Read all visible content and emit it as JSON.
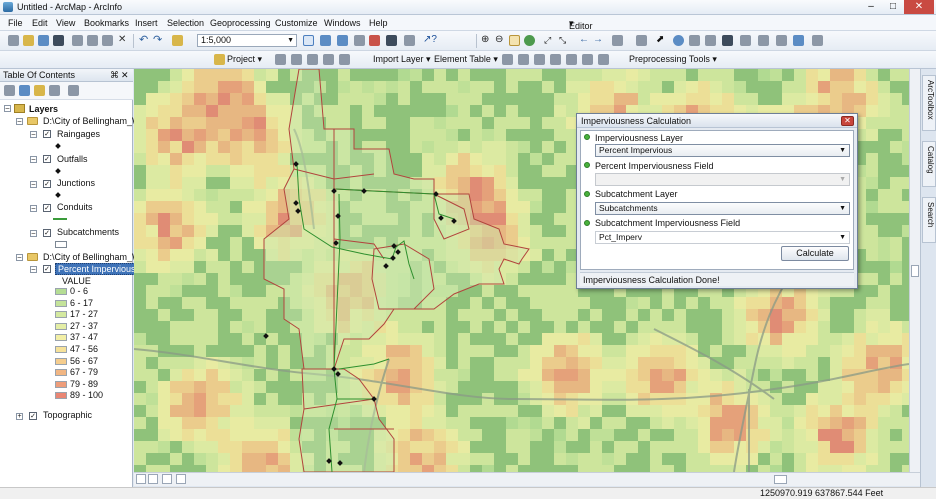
{
  "window": {
    "title": "Untitled - ArcMap - ArcInfo"
  },
  "menu": [
    "File",
    "Edit",
    "View",
    "Bookmarks",
    "Insert",
    "Selection",
    "Geoprocessing",
    "Customize",
    "Windows",
    "Help"
  ],
  "toolbar": {
    "scale": "1:5,000",
    "editor_label": "Editor"
  },
  "toolbar2": {
    "project_label": "Project",
    "import_layer_label": "Import Layer",
    "element_table_label": "Element Table",
    "preprocessing_label": "Preprocessing Tools"
  },
  "toc": {
    "title": "Table Of Contents",
    "root": "Layers",
    "group1": "D:\\City of Bellingham_W",
    "layers": [
      "Raingages",
      "Outfalls",
      "Junctions",
      "Conduits",
      "Subcatchments"
    ],
    "group2": "D:\\City of Bellingham_W",
    "raster_layer": "Percent Impervious",
    "value_header": "VALUE",
    "legend": [
      {
        "label": "0 - 6",
        "color": "#b5dd94"
      },
      {
        "label": "6 - 17",
        "color": "#c4e39a"
      },
      {
        "label": "17 - 27",
        "color": "#d4e9a0"
      },
      {
        "label": "27 - 37",
        "color": "#e4eea6"
      },
      {
        "label": "37 - 47",
        "color": "#f2efa6"
      },
      {
        "label": "47 - 56",
        "color": "#f6e29a"
      },
      {
        "label": "56 - 67",
        "color": "#f5cd8e"
      },
      {
        "label": "67 - 79",
        "color": "#f1b683"
      },
      {
        "label": "79 - 89",
        "color": "#ee9d7a"
      },
      {
        "label": "89 - 100",
        "color": "#e98674"
      }
    ],
    "basemap": "Topographic"
  },
  "right_tabs": [
    "ArcToolbox",
    "Catalog",
    "Search"
  ],
  "dialog": {
    "title": "Imperviousness Calculation",
    "layer_label": "Imperviousness Layer",
    "layer_value": "Percent Impervious",
    "field_label": "Percent Imperviousness Field",
    "field_value": "",
    "sub_label": "Subcatchment Layer",
    "sub_value": "Subcatchments",
    "sub_field_label": "Subcatchment Imperviousness Field",
    "sub_field_value": "Pct_Imperv",
    "calculate_label": "Calculate",
    "status": "Imperviousness Calculation Done!"
  },
  "status": {
    "coords": "1250970.919  637867.544 Feet"
  }
}
